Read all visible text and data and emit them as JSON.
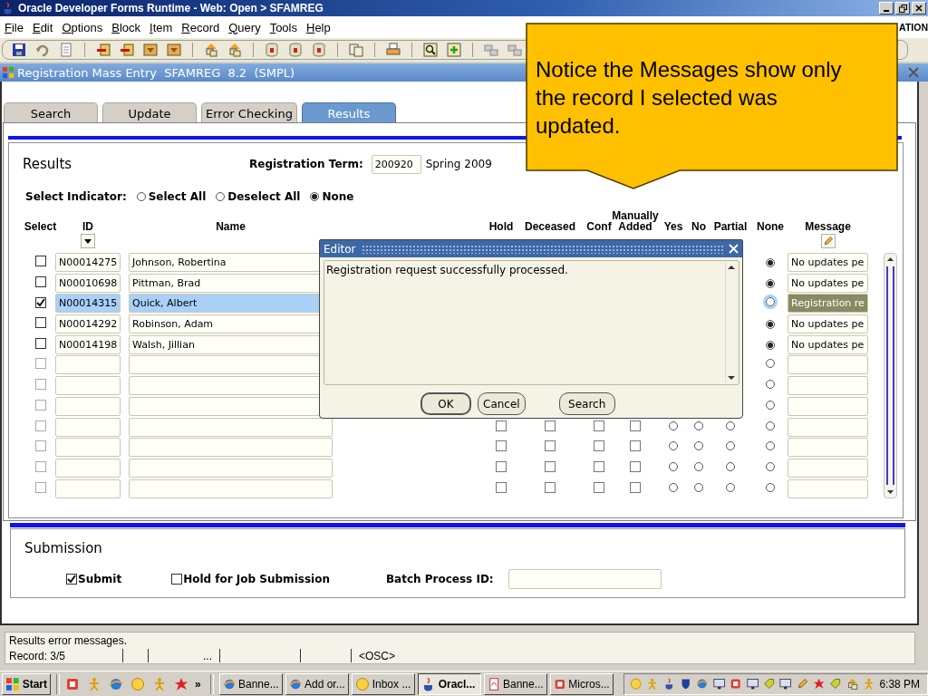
{
  "window": {
    "title": "Oracle Developer Forms Runtime - Web: Open > SFAMREG"
  },
  "menu": [
    "File",
    "Edit",
    "Options",
    "Block",
    "Item",
    "Record",
    "Query",
    "Tools",
    "Help"
  ],
  "branding": "ATION",
  "form": {
    "title": "Registration Mass Entry  SFAMREG  8.2  (SMPL)"
  },
  "tabs": [
    {
      "label": "Search",
      "selected": false
    },
    {
      "label": "Update",
      "selected": false
    },
    {
      "label": "Error Checking",
      "selected": false
    },
    {
      "label": "Results",
      "selected": true
    }
  ],
  "results": {
    "heading": "Results",
    "term_label": "Registration Term:",
    "term": "200920",
    "term_description": "Spring 2009",
    "select_indicator": {
      "label": "Select Indicator:",
      "options": [
        {
          "label": "Select All",
          "selected": false
        },
        {
          "label": "Deselect All",
          "selected": false
        },
        {
          "label": "None",
          "selected": true
        }
      ]
    },
    "columns": [
      "Select",
      "ID",
      "Name",
      "Hold",
      "Deceased",
      "Conf",
      "Manually Added",
      "Yes",
      "No",
      "Partial",
      "None",
      "Message"
    ],
    "rows": [
      {
        "select": false,
        "disabled": false,
        "selected": false,
        "id": "N00014275",
        "name": "Johnson, Robertina",
        "none": true,
        "message": "No updates pe"
      },
      {
        "select": false,
        "disabled": false,
        "selected": false,
        "id": "N00010698",
        "name": "Pittman, Brad",
        "none": true,
        "message": "No updates pe"
      },
      {
        "select": true,
        "disabled": false,
        "selected": true,
        "id": "N00014315",
        "name": "Quick, Albert",
        "none": false,
        "message": "Registration re"
      },
      {
        "select": false,
        "disabled": false,
        "selected": false,
        "id": "N00014292",
        "name": "Robinson, Adam",
        "none": true,
        "message": "No updates pe"
      },
      {
        "select": false,
        "disabled": false,
        "selected": false,
        "id": "N00014198",
        "name": "Walsh, Jillian",
        "none": true,
        "message": "No updates pe"
      },
      {
        "select": false,
        "disabled": true,
        "selected": false,
        "none": false
      },
      {
        "select": false,
        "disabled": true,
        "selected": false,
        "none": false
      },
      {
        "select": false,
        "disabled": true,
        "selected": false,
        "none": false
      },
      {
        "select": false,
        "disabled": true,
        "selected": false,
        "hold": false,
        "deceased": false,
        "conf": false,
        "manually_added": false,
        "yes": false,
        "no": false,
        "partial": false,
        "none": false
      },
      {
        "select": false,
        "disabled": true,
        "selected": false,
        "hold": false,
        "deceased": false,
        "conf": false,
        "manually_added": false,
        "yes": false,
        "no": false,
        "partial": false,
        "none": false
      },
      {
        "select": false,
        "disabled": true,
        "selected": false,
        "hold": false,
        "deceased": false,
        "conf": false,
        "manually_added": false,
        "yes": false,
        "no": false,
        "partial": false,
        "none": false
      },
      {
        "select": false,
        "disabled": true,
        "selected": false,
        "hold": false,
        "deceased": false,
        "conf": false,
        "manually_added": false,
        "yes": false,
        "no": false,
        "partial": false,
        "none": false
      }
    ]
  },
  "submission": {
    "heading": "Submission",
    "submit": {
      "label": "Submit",
      "checked": true
    },
    "hold": {
      "label": "Hold for Job Submission",
      "checked": false
    },
    "batch_label": "Batch Process ID:"
  },
  "editor": {
    "title": "Editor",
    "text": "Registration request successfully processed.",
    "buttons": [
      "OK",
      "Cancel",
      "Search"
    ]
  },
  "callout": {
    "text": "Notice the Messages show only the record I selected was updated."
  },
  "status_bar": {
    "message": "Results error messages.",
    "record": "Record: 3/5",
    "ellipsis": "...",
    "mode": "<OSC>"
  },
  "taskbar": {
    "start": "Start",
    "overflow": "»",
    "tasks": [
      {
        "label": "Banne...",
        "selected": false
      },
      {
        "label": "Add or...",
        "selected": false
      },
      {
        "label": "Inbox ...",
        "selected": false
      },
      {
        "label": "Oracl...",
        "selected": true
      },
      {
        "label": "Banne...",
        "selected": false
      },
      {
        "label": "Micros...",
        "selected": false
      }
    ],
    "clock": "6:38 PM"
  }
}
